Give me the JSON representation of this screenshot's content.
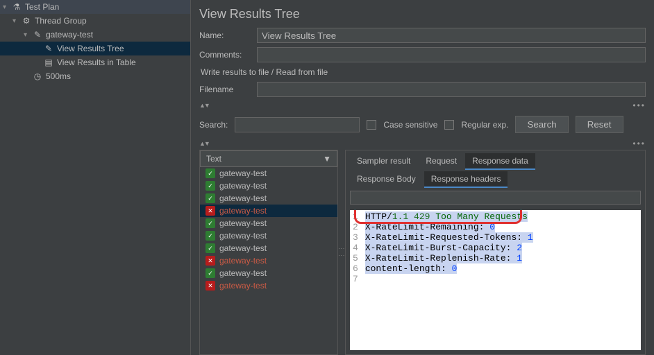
{
  "sidebar": {
    "items": [
      {
        "label": "Test Plan",
        "indent": 0,
        "icon": "flask-icon",
        "chevron": "▾"
      },
      {
        "label": "Thread Group",
        "indent": 1,
        "icon": "gear-icon",
        "chevron": "▾"
      },
      {
        "label": "gateway-test",
        "indent": 2,
        "icon": "pencil-icon",
        "chevron": "▾"
      },
      {
        "label": "View Results Tree",
        "indent": 3,
        "icon": "pencil-icon",
        "chevron": "",
        "selected": true
      },
      {
        "label": "View Results in Table",
        "indent": 3,
        "icon": "table-icon",
        "chevron": ""
      },
      {
        "label": "500ms",
        "indent": 2,
        "icon": "clock-icon",
        "chevron": ""
      }
    ]
  },
  "panel": {
    "title": "View Results Tree",
    "name_label": "Name:",
    "name_value": "View Results Tree",
    "comments_label": "Comments:",
    "section1": "Write results to file / Read from file",
    "filename_label": "Filename",
    "search_label": "Search:",
    "case_sensitive": "Case sensitive",
    "regular_exp": "Regular exp.",
    "search_btn": "Search",
    "reset_btn": "Reset",
    "more": "•••",
    "collapse_tri": "▲▼"
  },
  "resultsType": "Text",
  "results": [
    {
      "name": "gateway-test",
      "status": "pass"
    },
    {
      "name": "gateway-test",
      "status": "pass"
    },
    {
      "name": "gateway-test",
      "status": "pass"
    },
    {
      "name": "gateway-test",
      "status": "fail"
    },
    {
      "name": "gateway-test",
      "status": "pass"
    },
    {
      "name": "gateway-test",
      "status": "pass"
    },
    {
      "name": "gateway-test",
      "status": "pass"
    },
    {
      "name": "gateway-test",
      "status": "fail"
    },
    {
      "name": "gateway-test",
      "status": "pass"
    },
    {
      "name": "gateway-test",
      "status": "fail"
    }
  ],
  "tabs": {
    "main": [
      "Sampler result",
      "Request",
      "Response data"
    ],
    "mainActive": 2,
    "sub": [
      "Response Body",
      "Response headers"
    ],
    "subActive": 1
  },
  "response": {
    "lines": [
      {
        "n": 1,
        "parts": [
          {
            "t": "HTTP",
            "c": "tok-http"
          },
          {
            "t": "/",
            "c": "tok-http"
          },
          {
            "t": "1.1 429",
            "c": "tok-ver"
          },
          {
            "t": " ",
            "c": ""
          },
          {
            "t": "Too Many Requests",
            "c": "tok-msg"
          }
        ]
      },
      {
        "n": 2,
        "parts": [
          {
            "t": "X-RateLimit-Remaining:",
            "c": "tok-hdr"
          },
          {
            "t": " ",
            "c": ""
          },
          {
            "t": "0",
            "c": "tok-num"
          }
        ]
      },
      {
        "n": 3,
        "parts": [
          {
            "t": "X-RateLimit-Requested-Tokens:",
            "c": "tok-hdr"
          },
          {
            "t": " ",
            "c": ""
          },
          {
            "t": "1",
            "c": "tok-num"
          }
        ]
      },
      {
        "n": 4,
        "parts": [
          {
            "t": "X-RateLimit-Burst-Capacity:",
            "c": "tok-hdr"
          },
          {
            "t": " ",
            "c": ""
          },
          {
            "t": "2",
            "c": "tok-num"
          }
        ]
      },
      {
        "n": 5,
        "parts": [
          {
            "t": "X-RateLimit-Replenish-Rate:",
            "c": "tok-hdr"
          },
          {
            "t": " ",
            "c": ""
          },
          {
            "t": "1",
            "c": "tok-num"
          }
        ]
      },
      {
        "n": 6,
        "parts": [
          {
            "t": "content-length:",
            "c": "tok-hdr"
          },
          {
            "t": " ",
            "c": ""
          },
          {
            "t": "0",
            "c": "tok-num"
          }
        ]
      },
      {
        "n": 7,
        "parts": []
      }
    ]
  },
  "icons": {
    "flask-icon": "⚗",
    "gear-icon": "⚙",
    "pencil-icon": "✎",
    "table-icon": "▤",
    "clock-icon": "◷",
    "shield-pass": "✓",
    "shield-fail": "✕",
    "chevron-down": "▼"
  }
}
